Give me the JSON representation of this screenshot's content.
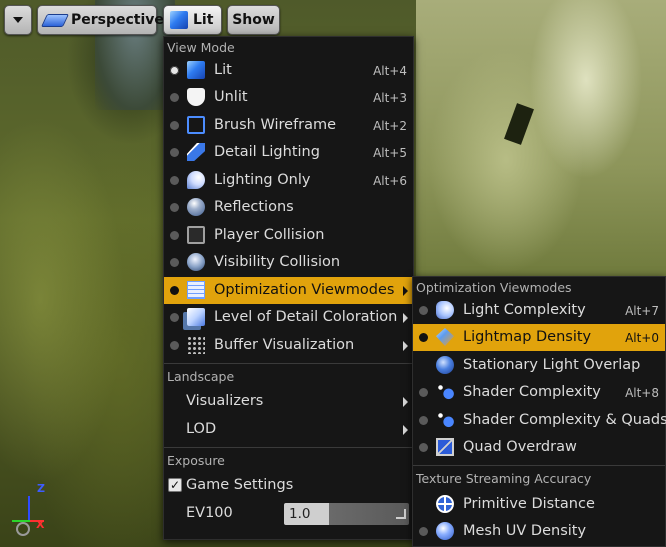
{
  "toolbar": {
    "perspective_label": "Perspective",
    "lit_label": "Lit",
    "show_label": "Show"
  },
  "view_mode": {
    "header": "View Mode",
    "items": [
      {
        "label": "Lit",
        "shortcut": "Alt+4",
        "icon": "lit-cube-icon",
        "selected": true
      },
      {
        "label": "Unlit",
        "shortcut": "Alt+3",
        "icon": "unlit-shield-icon"
      },
      {
        "label": "Brush Wireframe",
        "shortcut": "Alt+2",
        "icon": "wireframe-cube-icon"
      },
      {
        "label": "Detail Lighting",
        "shortcut": "Alt+5",
        "icon": "flashlight-icon"
      },
      {
        "label": "Lighting Only",
        "shortcut": "Alt+6",
        "icon": "lightbulb-icon"
      },
      {
        "label": "Reflections",
        "shortcut": "",
        "icon": "reflection-sphere-icon"
      },
      {
        "label": "Player Collision",
        "shortcut": "",
        "icon": "collision-cube-icon"
      },
      {
        "label": "Visibility Collision",
        "shortcut": "",
        "icon": "visibility-sphere-icon"
      },
      {
        "label": "Optimization Viewmodes",
        "shortcut": "",
        "icon": "grid-icon",
        "highlighted": true,
        "submenu": true
      },
      {
        "label": "Level of Detail Coloration",
        "shortcut": "",
        "icon": "lod-icon",
        "submenu": true
      },
      {
        "label": "Buffer Visualization",
        "shortcut": "",
        "icon": "dots-grid-icon",
        "submenu": true
      }
    ]
  },
  "landscape": {
    "header": "Landscape",
    "items": [
      {
        "label": "Visualizers"
      },
      {
        "label": "LOD"
      }
    ]
  },
  "exposure": {
    "header": "Exposure",
    "game_settings_label": "Game Settings",
    "game_settings_checked": true,
    "ev100_label": "EV100",
    "ev100_value": "1.0"
  },
  "optimization_submenu": {
    "header": "Optimization Viewmodes",
    "items": [
      {
        "label": "Light Complexity",
        "shortcut": "Alt+7",
        "icon": "light-complexity-icon"
      },
      {
        "label": "Lightmap Density",
        "shortcut": "Alt+0",
        "icon": "lightmap-icon",
        "highlighted": true
      },
      {
        "label": "Stationary Light Overlap",
        "shortcut": "",
        "icon": "stationary-light-icon"
      },
      {
        "label": "Shader Complexity",
        "shortcut": "Alt+8",
        "icon": "shader-sparkle-icon"
      },
      {
        "label": "Shader Complexity & Quads",
        "shortcut": "",
        "icon": "shader-quads-icon"
      },
      {
        "label": "Quad Overdraw",
        "shortcut": "",
        "icon": "quad-icon"
      }
    ],
    "texture_header": "Texture Streaming Accuracy",
    "texture_items": [
      {
        "label": "Primitive Distance",
        "icon": "crosshair-icon"
      },
      {
        "label": "Mesh UV Density",
        "icon": "mesh-sphere-icon"
      }
    ]
  },
  "gizmo": {
    "z": "Z",
    "x": "X"
  },
  "colors": {
    "highlight": "#e1a30c",
    "menu_bg": "#161616"
  }
}
